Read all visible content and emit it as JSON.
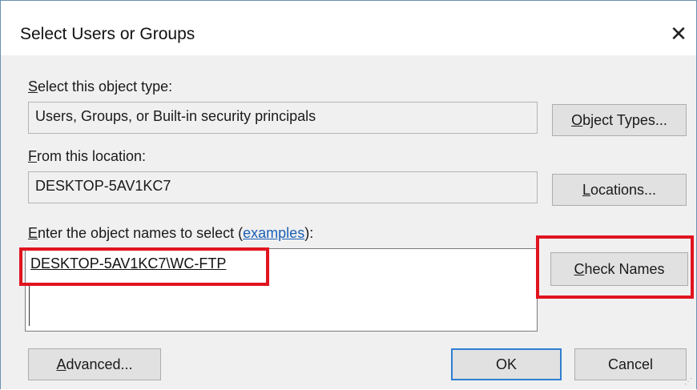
{
  "dialog": {
    "title": "Select Users or Groups",
    "close_glyph": "✕"
  },
  "object_type": {
    "label_first": "S",
    "label_rest": "elect this object type:",
    "value": "Users, Groups, or Built-in security principals",
    "button_first": "O",
    "button_rest": "bject Types..."
  },
  "location": {
    "label_first": "F",
    "label_rest": "rom this location:",
    "value": "DESKTOP-5AV1KC7",
    "button_first": "L",
    "button_rest": "ocations..."
  },
  "names": {
    "label_first": "E",
    "label_rest": "nter the object names to select (",
    "link": "examples",
    "label_end": "):",
    "value": "DESKTOP-5AV1KC7\\WC-FTP",
    "check_first": "C",
    "check_rest": "heck Names"
  },
  "footer": {
    "advanced_first": "A",
    "advanced_rest": "dvanced...",
    "ok": "OK",
    "cancel": "Cancel"
  },
  "colors": {
    "highlight": "#e0141f",
    "default_button_border": "#2f7fd1",
    "link": "#1a5fb4"
  }
}
